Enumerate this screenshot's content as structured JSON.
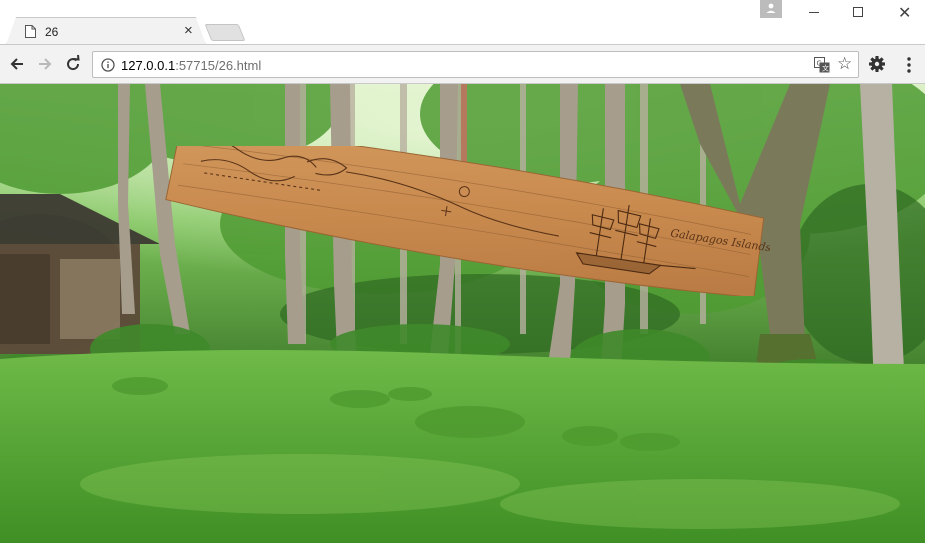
{
  "browser": {
    "tab": {
      "title": "26"
    },
    "url": {
      "host": "127.0.0.1",
      "rest": ":57715/26.html"
    }
  },
  "page": {
    "sign_text": "Galapagos Islands"
  },
  "icons": {
    "tab": "document-icon",
    "back": "arrow-left-icon",
    "forward": "arrow-right-icon",
    "reload": "reload-icon",
    "info": "info-icon",
    "translate": "translate-icon",
    "bookmark": "star-icon",
    "extension": "gear-icon",
    "menu": "kebab-menu-icon"
  },
  "colors": {
    "chrome_frame": "#f2f2f2",
    "moss": "#5aa83a",
    "plank": "#c98a4e",
    "ink": "#5a3418"
  }
}
